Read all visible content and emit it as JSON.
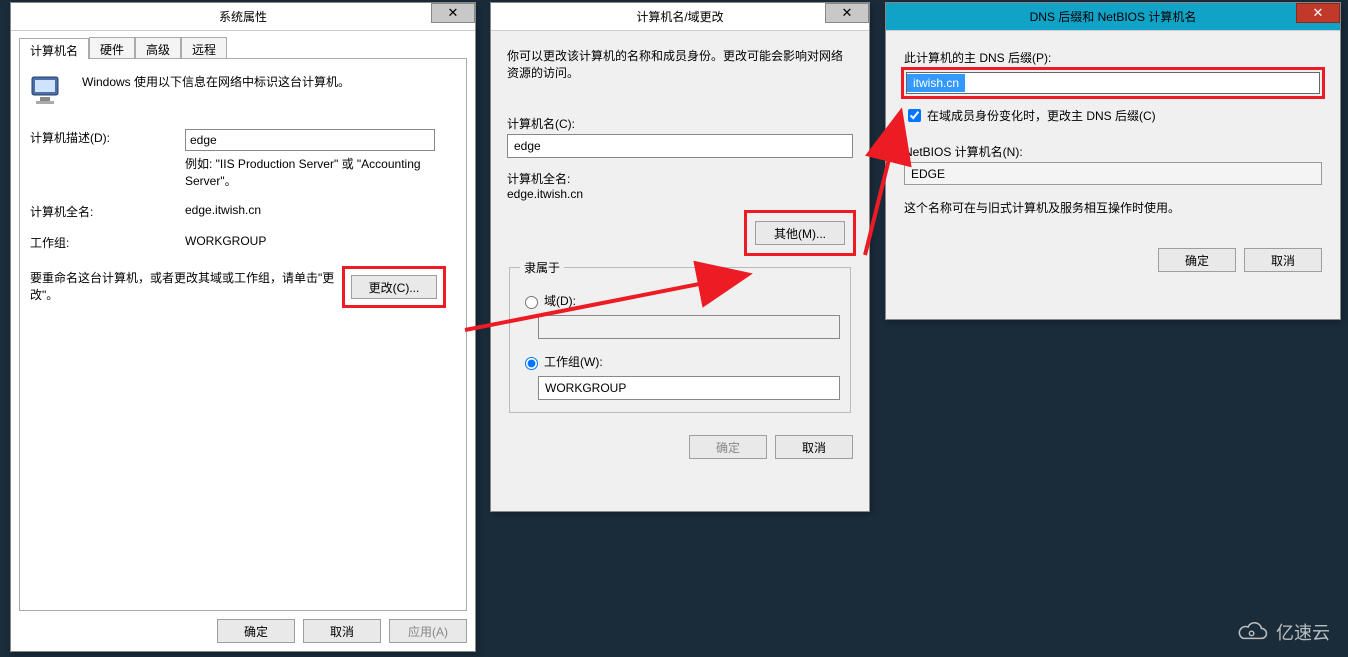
{
  "dlg1": {
    "title": "系统属性",
    "tabs": [
      {
        "label": "计算机名",
        "active": true
      },
      {
        "label": "硬件",
        "active": false
      },
      {
        "label": "高级",
        "active": false
      },
      {
        "label": "远程",
        "active": false
      }
    ],
    "intro": "Windows 使用以下信息在网络中标识这台计算机。",
    "desc_label": "计算机描述(D):",
    "desc_value": "edge",
    "desc_hint": "例如: \"IIS Production Server\" 或 \"Accounting Server\"。",
    "fullname_label": "计算机全名:",
    "fullname_value": "edge.itwish.cn",
    "workgroup_label": "工作组:",
    "workgroup_value": "WORKGROUP",
    "rename_hint": "要重命名这台计算机，或者更改其域或工作组，请单击\"更改\"。",
    "change_btn": "更改(C)...",
    "ok": "确定",
    "cancel": "取消",
    "apply": "应用(A)"
  },
  "dlg2": {
    "title": "计算机名/域更改",
    "intro": "你可以更改该计算机的名称和成员身份。更改可能会影响对网络资源的访问。",
    "name_label": "计算机名(C):",
    "name_value": "edge",
    "fullname_label": "计算机全名:",
    "fullname_value": "edge.itwish.cn",
    "more_btn": "其他(M)...",
    "member_legend": "隶属于",
    "domain_label": "域(D):",
    "domain_value": "",
    "workgroup_label": "工作组(W):",
    "workgroup_value": "WORKGROUP",
    "ok": "确定",
    "cancel": "取消"
  },
  "dlg3": {
    "title": "DNS 后缀和 NetBIOS 计算机名",
    "primary_label": "此计算机的主 DNS 后缀(P):",
    "primary_value": "itwish.cn",
    "chk_label": "在域成员身份变化时，更改主 DNS 后缀(C)",
    "chk_checked": true,
    "netbios_label": "NetBIOS 计算机名(N):",
    "netbios_value": "EDGE",
    "note": "这个名称可在与旧式计算机及服务相互操作时使用。",
    "ok": "确定",
    "cancel": "取消"
  },
  "watermark": "亿速云"
}
